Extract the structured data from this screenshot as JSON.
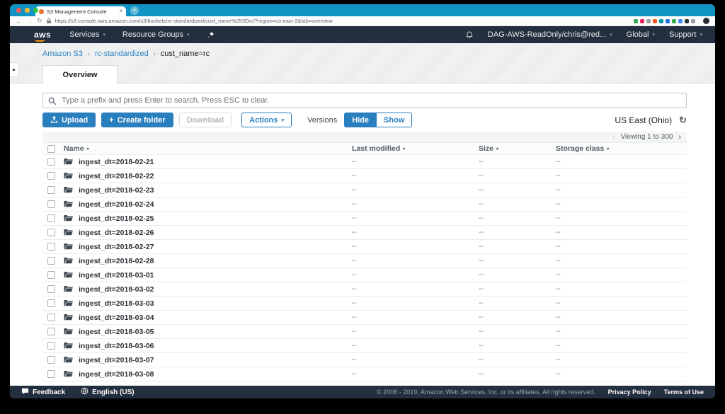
{
  "browser": {
    "tab_title": "S3 Management Console",
    "url": "https://s3.console.aws.amazon.com/s3/buckets/rc-standardized/cust_name%253Drc/?region=us-east-2&tab=overview",
    "extension_colors": [
      "#34a853",
      "#e91e63",
      "#9e9e9e",
      "#ff5722",
      "#0097a7",
      "#1a73e8",
      "#34a853",
      "#4285f4",
      "#2d3436",
      "#9aa0a6"
    ]
  },
  "icons": {
    "caret_down": "▾",
    "breadcrumb_sep": "›",
    "chevron_left": "‹",
    "chevron_right": "›",
    "plus": "+",
    "refresh": "↻",
    "back": "←",
    "forward": "→",
    "reload": "↻",
    "close": "×",
    "new_tab": "+",
    "expand": "▶"
  },
  "nav": {
    "logo": "aws",
    "services": "Services",
    "resource_groups": "Resource Groups",
    "account": "DAG-AWS-ReadOnly/chris@red...",
    "global": "Global",
    "support": "Support"
  },
  "breadcrumb": {
    "items": [
      "Amazon S3",
      "rc-standardized",
      "cust_name=rc"
    ]
  },
  "tabs": {
    "overview": "Overview"
  },
  "toolbar": {
    "search_placeholder": "Type a prefix and press Enter to search. Press ESC to clear.",
    "upload": "Upload",
    "create_folder": "Create folder",
    "download": "Download",
    "actions": "Actions",
    "versions_label": "Versions",
    "hide": "Hide",
    "show": "Show",
    "region": "US East (Ohio)"
  },
  "table": {
    "viewing": "Viewing 1 to 300",
    "headers": [
      "Name",
      "Last modified",
      "Size",
      "Storage class"
    ],
    "empty_value": "--",
    "rows": [
      "ingest_dt=2018-02-21",
      "ingest_dt=2018-02-22",
      "ingest_dt=2018-02-23",
      "ingest_dt=2018-02-24",
      "ingest_dt=2018-02-25",
      "ingest_dt=2018-02-26",
      "ingest_dt=2018-02-27",
      "ingest_dt=2018-02-28",
      "ingest_dt=2018-03-01",
      "ingest_dt=2018-03-02",
      "ingest_dt=2018-03-03",
      "ingest_dt=2018-03-04",
      "ingest_dt=2018-03-05",
      "ingest_dt=2018-03-06",
      "ingest_dt=2018-03-07",
      "ingest_dt=2018-03-08"
    ]
  },
  "footer": {
    "feedback": "Feedback",
    "language": "English (US)",
    "copyright": "© 2008 - 2019, Amazon Web Services, Inc. or its affiliates. All rights reserved.",
    "privacy": "Privacy Policy",
    "terms": "Terms of Use"
  },
  "colors": {
    "chrome_teal": "#1193c4",
    "nav_dark": "#232f3e",
    "button_blue": "#2a7fbe",
    "link_blue": "#2d84c4",
    "row_border": "#eaeded"
  }
}
